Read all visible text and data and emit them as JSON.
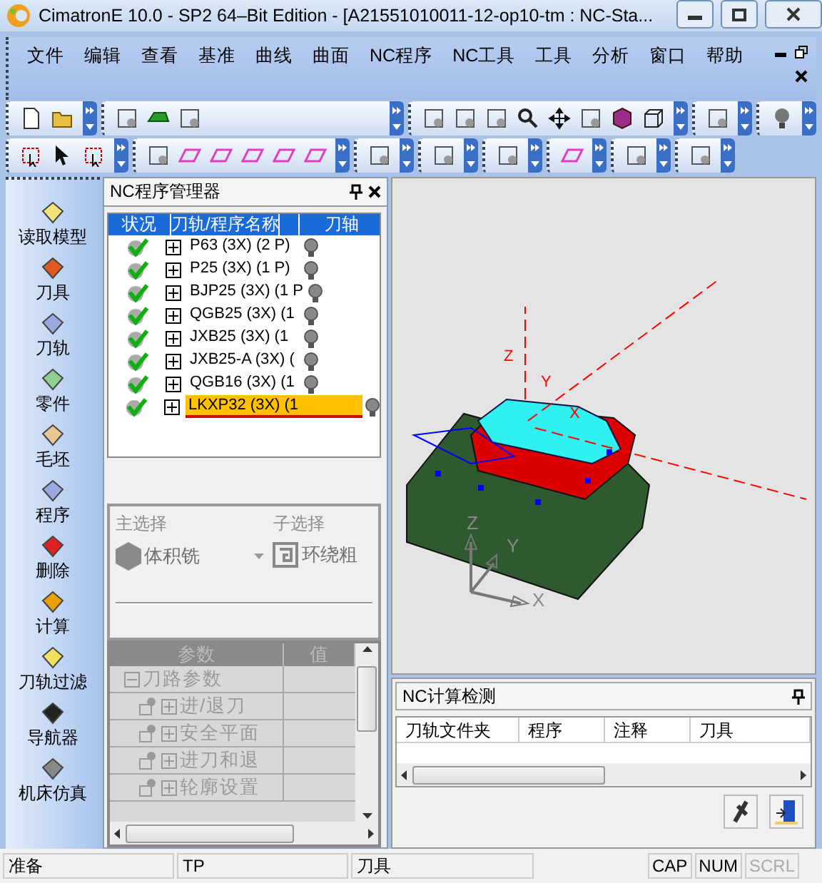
{
  "window": {
    "title": "CimatronE 10.0 - SP2 64–Bit Edition - [A21551010011-12-op10-tm : NC-Sta..."
  },
  "menu": [
    "文件",
    "编辑",
    "查看",
    "基准",
    "曲线",
    "曲面",
    "NC程序",
    "NC工具",
    "工具",
    "分析",
    "窗口",
    "帮助"
  ],
  "sidebar": {
    "items": [
      "读取模型",
      "刀具",
      "刀轨",
      "零件",
      "毛坯",
      "程序",
      "删除",
      "计算",
      "刀轨过滤",
      "导航器",
      "机床仿真"
    ]
  },
  "nc_manager": {
    "title": "NC程序管理器",
    "columns": [
      "状况",
      "刀轨/程序名称",
      "",
      "刀轴"
    ],
    "rows": [
      {
        "name": "P63 (3X) (2 P)",
        "done": true,
        "expanded": false,
        "selected": false
      },
      {
        "name": "P25 (3X) (1 P)",
        "done": true,
        "expanded": false,
        "selected": false
      },
      {
        "name": "BJP25 (3X) (1 P",
        "done": true,
        "expanded": false,
        "selected": false
      },
      {
        "name": "QGB25 (3X) (1",
        "done": true,
        "expanded": false,
        "selected": false
      },
      {
        "name": "JXB25 (3X) (1",
        "done": true,
        "expanded": false,
        "selected": false
      },
      {
        "name": "JXB25-A (3X) (",
        "done": true,
        "expanded": false,
        "selected": false
      },
      {
        "name": "QGB16 (3X) (1",
        "done": true,
        "expanded": false,
        "selected": false
      },
      {
        "name": "LKXP32 (3X) (1",
        "done": true,
        "expanded": false,
        "selected": true
      }
    ]
  },
  "selection": {
    "disabled": true,
    "main_label": "主选择",
    "main_value": "体积铣",
    "sub_label": "子选择",
    "sub_value": "环绕粗"
  },
  "parameters": {
    "disabled": true,
    "columns": [
      "参数",
      "值"
    ],
    "rows": [
      {
        "label": "刀路参数",
        "expanded": true,
        "children": [
          {
            "label": "进/退刀",
            "expanded": false
          },
          {
            "label": "安全平面",
            "expanded": false
          },
          {
            "label": "进刀和退",
            "expanded": false
          },
          {
            "label": "轮廓设置",
            "expanded": false
          }
        ]
      }
    ]
  },
  "viewport": {
    "axis_labels": [
      "Z",
      "Y",
      "X"
    ],
    "triad_labels": [
      "Z",
      "Y",
      "X"
    ]
  },
  "nc_check": {
    "title": "NC计算检测",
    "columns": [
      "刀轨文件夹",
      "程序",
      "注释",
      "刀具"
    ]
  },
  "status_bar": {
    "fields": [
      "准备",
      "TP",
      "刀具"
    ],
    "indicators": [
      {
        "label": "CAP",
        "on": true
      },
      {
        "label": "NUM",
        "on": true
      },
      {
        "label": "SCRL",
        "on": false
      }
    ]
  }
}
